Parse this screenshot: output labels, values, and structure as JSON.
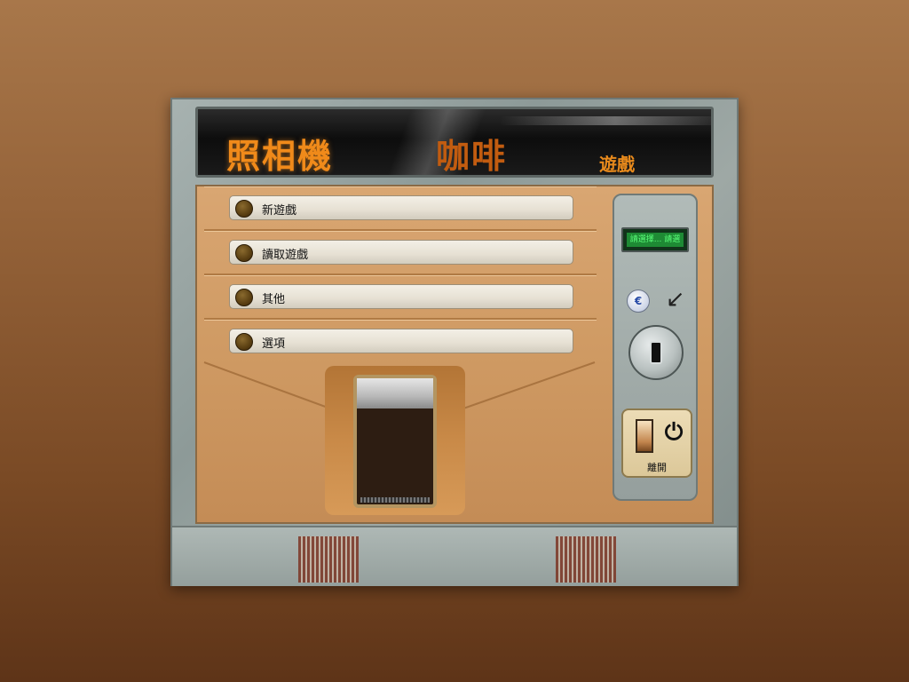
{
  "marquee": {
    "title_main": "照相機",
    "title_coffee": "咖啡",
    "title_game": "遊戲"
  },
  "menu": {
    "items": [
      {
        "label": "新遊戲"
      },
      {
        "label": "讀取遊戲"
      },
      {
        "label": "其他"
      },
      {
        "label": "選項"
      }
    ]
  },
  "control_panel": {
    "display_text": "請選擇... 請選",
    "coin_icon": "coin-icon",
    "arrow_icon": "arrow-down-left-icon",
    "exit_label": "離開",
    "power_icon": "power-icon"
  },
  "colors": {
    "marquee_text": "#f08a1a",
    "coffee_text": "#c25c10",
    "led_green": "#5bff7a"
  }
}
